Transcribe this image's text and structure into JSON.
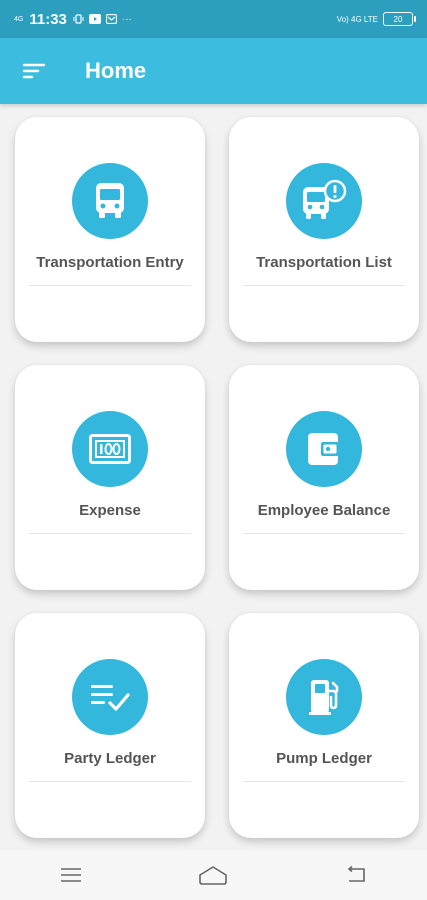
{
  "status_bar": {
    "time": "11:33",
    "network_left": "4G",
    "network_right": "Vo) 4G LTE",
    "battery": "20",
    "more": "···"
  },
  "app_bar": {
    "title": "Home",
    "menu_icon": "sort-menu-icon"
  },
  "cards": [
    {
      "label": "Transportation Entry",
      "icon": "bus-icon"
    },
    {
      "label": "Transportation List",
      "icon": "bus-alert-icon"
    },
    {
      "label": "Expense",
      "icon": "cash-icon"
    },
    {
      "label": "Employee Balance",
      "icon": "wallet-icon"
    },
    {
      "label": "Party Ledger",
      "icon": "list-check-icon"
    },
    {
      "label": "Pump Ledger",
      "icon": "fuel-pump-icon"
    }
  ],
  "colors": {
    "status_bar": "#2b9fbd",
    "app_bar": "#3cbde0",
    "icon_circle": "#33b7dd",
    "label": "#555555"
  },
  "nav_bar": {
    "menu_icon": "menu-icon",
    "home_icon": "home-icon",
    "back_icon": "back-icon"
  }
}
